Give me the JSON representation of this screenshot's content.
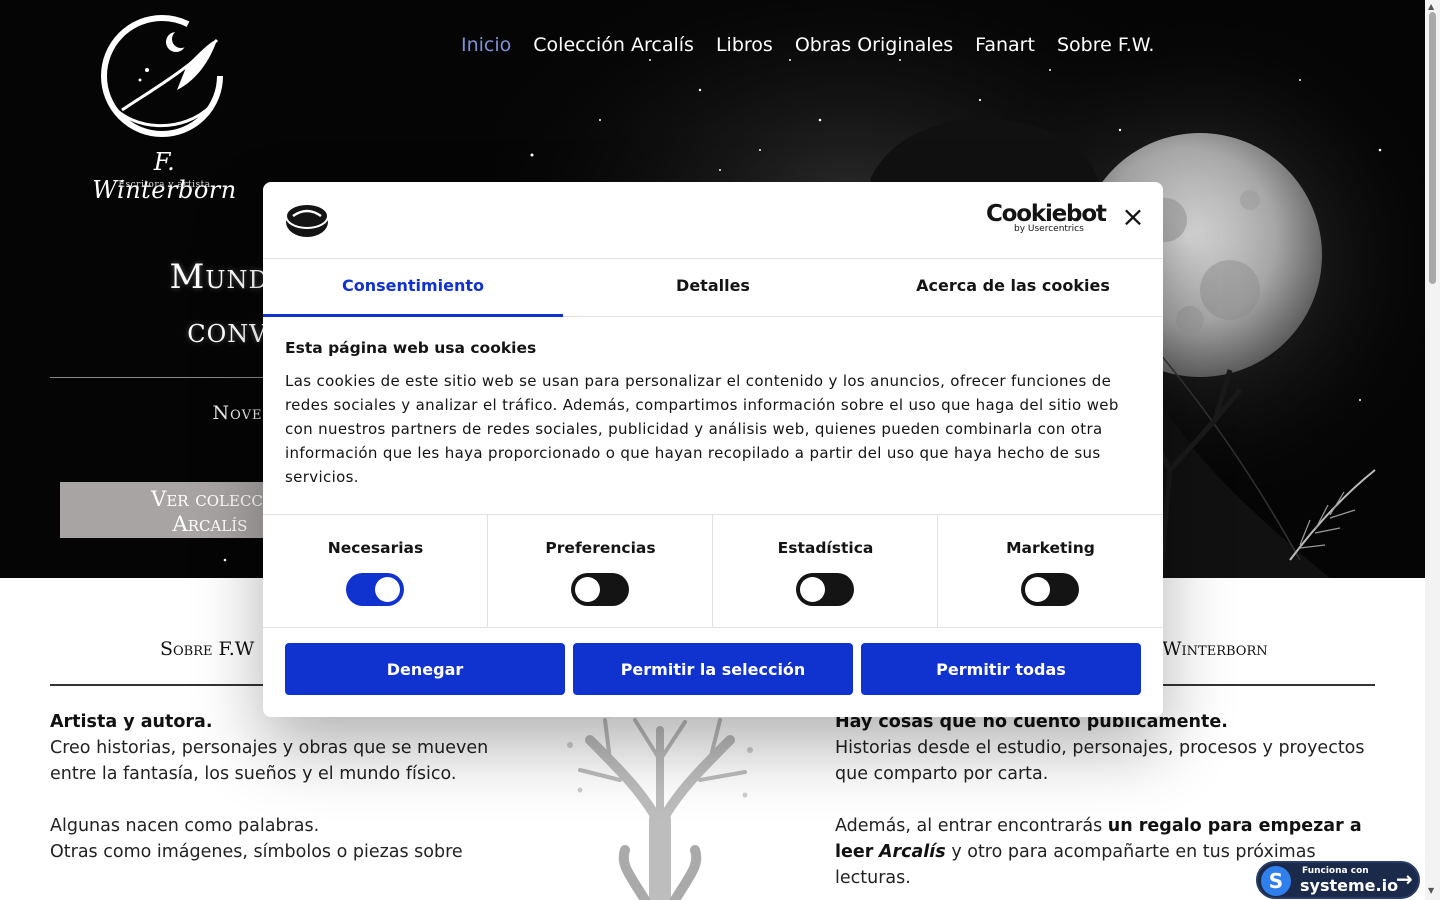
{
  "site": {
    "logo_name": "F. Winterborn",
    "logo_tagline": "Escritora y artista"
  },
  "nav": {
    "items": [
      {
        "label": "Inicio",
        "active": true
      },
      {
        "label": "Colección Arcalís"
      },
      {
        "label": "Libros"
      },
      {
        "label": "Obras Originales"
      },
      {
        "label": "Fanart"
      },
      {
        "label": "Sobre F.W."
      }
    ]
  },
  "hero": {
    "title_line1": "Mundos qu",
    "title_line2": "convierti",
    "subtitle": "Novelas, c",
    "cta_line1": "Ver colecci",
    "cta_line2": "Arcalís"
  },
  "content": {
    "left_heading": "Sobre F.W",
    "right_heading": "Winterborn",
    "left_bold": "Artista y autora.",
    "left_p1": "Creo historias, personajes y obras que se mueven entre la fantasía, los sueños y el mundo físico.",
    "left_p2a": "Algunas nacen como palabras.",
    "left_p2b": "Otras como imágenes, símbolos o piezas sobre",
    "right_bold": "Hay cosas que no cuento públicamente.",
    "right_p1": "Historias desde el estudio, personajes, procesos y proyectos que comparto por carta.",
    "right_p2_start": "Además, al entrar encontrarás",
    "right_p2_bold": "un regalo para empezar a leer",
    "right_p2_em": "Arcalís",
    "right_p2_end": "y otro para acompañarte en tus próximas lecturas."
  },
  "badge": {
    "small": "Funciona con",
    "big": "systeme.io"
  },
  "cookie": {
    "brand": "Cookiebot",
    "brand_by": "by Usercentrics",
    "tabs": [
      {
        "label": "Consentimiento",
        "active": true
      },
      {
        "label": "Detalles"
      },
      {
        "label": "Acerca de las cookies"
      }
    ],
    "heading": "Esta página web usa cookies",
    "text": "Las cookies de este sitio web se usan para personalizar el contenido y los anuncios, ofrecer funciones de redes sociales y analizar el tráfico. Además, compartimos información sobre el uso que haga del sitio web con nuestros partners de redes sociales, publicidad y análisis web, quienes pueden combinarla con otra información que les haya proporcionado o que hayan recopilado a partir del uso que haya hecho de sus servicios.",
    "toggles": [
      {
        "label": "Necesarias",
        "on": true
      },
      {
        "label": "Preferencias",
        "on": false
      },
      {
        "label": "Estadística",
        "on": false
      },
      {
        "label": "Marketing",
        "on": false
      }
    ],
    "buttons": {
      "deny": "Denegar",
      "allow_selection": "Permitir la selección",
      "allow_all": "Permitir todas"
    }
  },
  "colors": {
    "accent_blue": "#1032cf",
    "nav_active": "#7b92d6",
    "hero_bg": "#050505",
    "hero_button": "#a9a4a4",
    "badge_bg": "#1b2a4a"
  }
}
